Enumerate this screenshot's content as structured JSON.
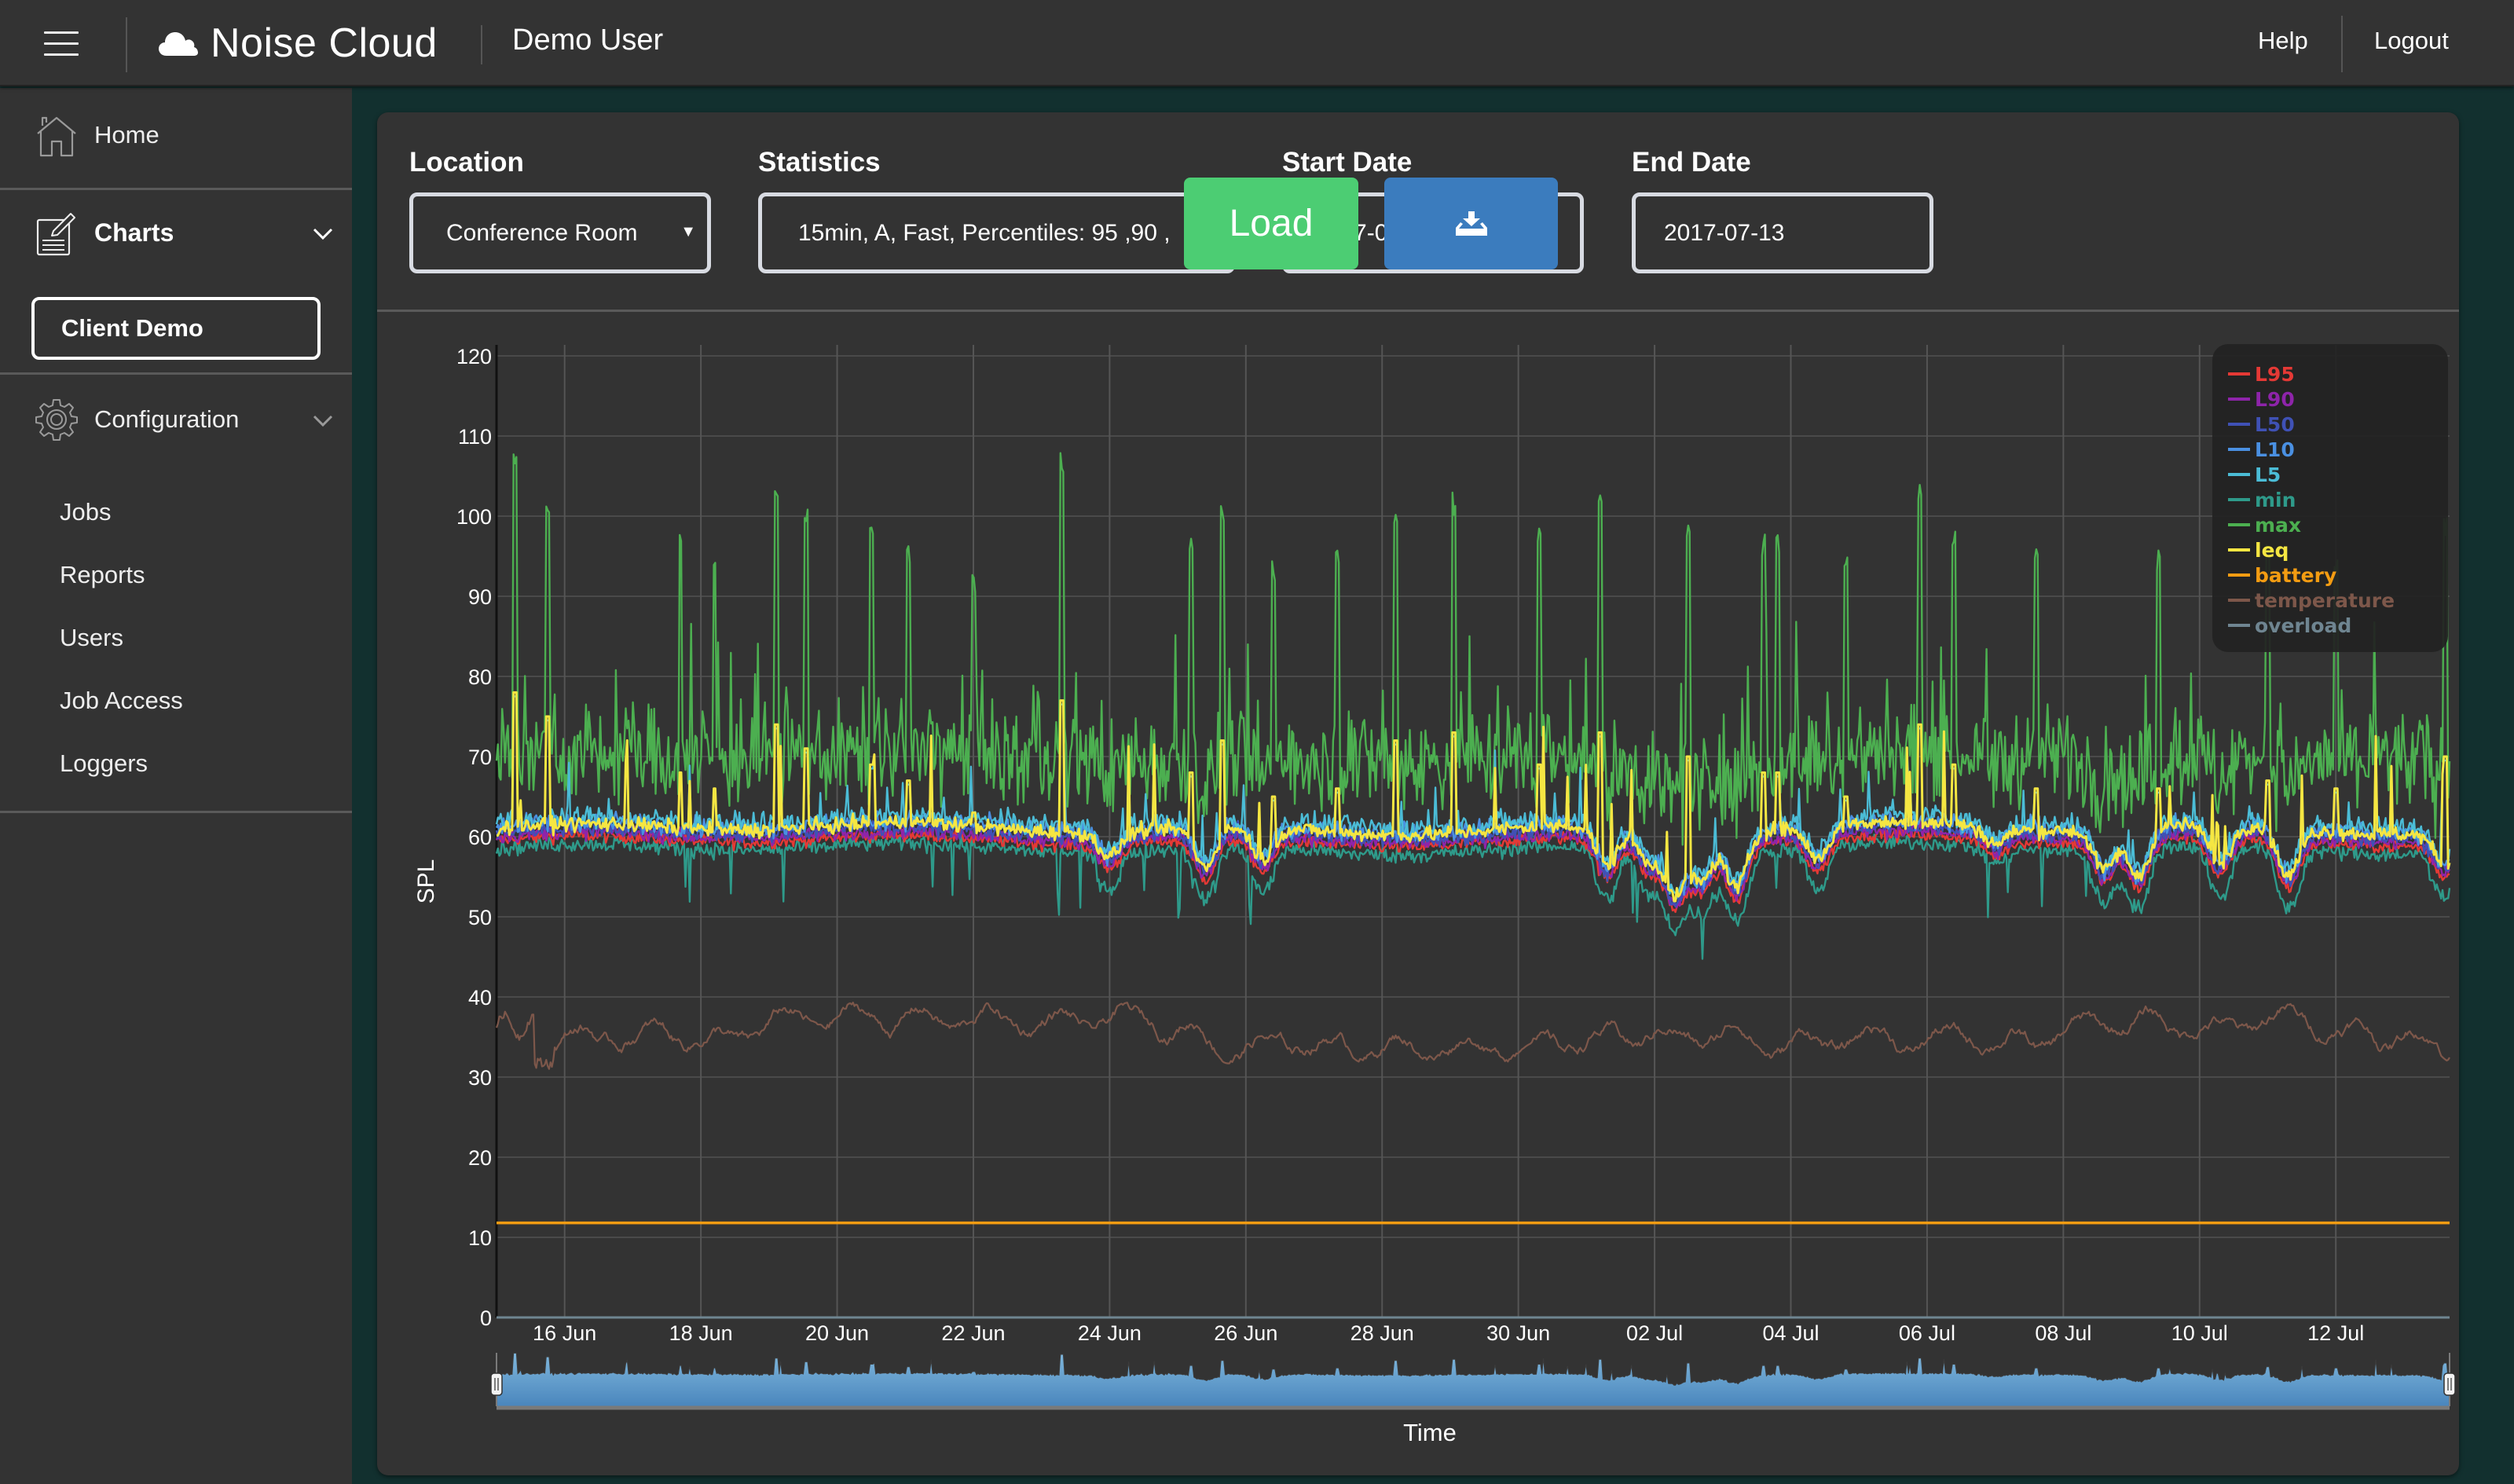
{
  "header": {
    "menu_icon": "hamburger-icon",
    "brand_icon": "cloud-icon",
    "brand": "Noise Cloud",
    "user": "Demo User",
    "help": "Help",
    "logout": "Logout"
  },
  "sidebar": {
    "home": {
      "label": "Home",
      "icon": "home-icon"
    },
    "charts": {
      "label": "Charts",
      "icon": "charts-edit-icon",
      "expanded": true,
      "children": [
        {
          "label": "Client Demo",
          "active": true
        }
      ]
    },
    "configuration": {
      "label": "Configuration",
      "icon": "gear-icon",
      "expanded": true,
      "children": [
        {
          "label": "Jobs"
        },
        {
          "label": "Reports"
        },
        {
          "label": "Users"
        },
        {
          "label": "Job Access"
        },
        {
          "label": "Loggers"
        }
      ]
    }
  },
  "filters": {
    "location": {
      "label": "Location",
      "value": "Conference Room"
    },
    "statistics": {
      "label": "Statistics",
      "value": "15min, A, Fast, Percentiles: 95 ,90 ,"
    },
    "start_date": {
      "label": "Start Date",
      "value": "2017-06-15"
    },
    "end_date": {
      "label": "End Date",
      "value": "2017-07-13"
    },
    "load_label": "Load",
    "download_icon": "download-tray-icon"
  },
  "chart_data": {
    "type": "line",
    "title": "",
    "xlabel": "Time",
    "ylabel": "SPL",
    "ylim": [
      0,
      120
    ],
    "yticks": [
      0,
      10,
      20,
      30,
      40,
      50,
      60,
      70,
      80,
      90,
      100,
      110,
      120
    ],
    "xlim": [
      "2017-06-15T00:00",
      "2017-07-13T16:00"
    ],
    "xticks": [
      "16 Jun",
      "18 Jun",
      "20 Jun",
      "22 Jun",
      "24 Jun",
      "26 Jun",
      "28 Jun",
      "30 Jun",
      "02 Jul",
      "04 Jul",
      "06 Jul",
      "08 Jul",
      "10 Jul",
      "12 Jul"
    ],
    "xtick_days": [
      1,
      3,
      5,
      7,
      9,
      11,
      13,
      15,
      17,
      19,
      21,
      23,
      25,
      27
    ],
    "grid": true,
    "legend_position": "top-right",
    "sample_interval": "15min",
    "series": [
      {
        "name": "L95",
        "color": "#e53935",
        "typical": 59.5,
        "noise": 0.8
      },
      {
        "name": "L90",
        "color": "#8e24aa",
        "typical": 60.0,
        "noise": 0.9
      },
      {
        "name": "L50",
        "color": "#3f51b5",
        "typical": 60.5,
        "noise": 1.0
      },
      {
        "name": "L10",
        "color": "#4a90e2",
        "typical": 61.3,
        "noise": 1.2
      },
      {
        "name": "L5",
        "color": "#4bbcd6",
        "typical": 61.8,
        "noise": 1.4
      },
      {
        "name": "min",
        "color": "#2e9a8a",
        "typical": 58.5,
        "noise": 1.0
      },
      {
        "name": "max",
        "color": "#4caf50",
        "typical": 70,
        "noise": 4.5
      },
      {
        "name": "leq",
        "color": "#f5e642",
        "typical": 61,
        "noise": 0.9
      },
      {
        "name": "battery",
        "color": "#f39c12",
        "typical": 11.8,
        "noise": 0
      },
      {
        "name": "temperature",
        "color": "#7d574a",
        "typical": 35,
        "noise": 1.6
      },
      {
        "name": "overload",
        "color": "#6f8591",
        "typical": 0,
        "noise": 0
      }
    ],
    "max_spikes": [
      {
        "day": 0.28,
        "max": 109,
        "leq": 78
      },
      {
        "day": 0.75,
        "max": 102,
        "leq": 75
      },
      {
        "day": 2.7,
        "max": 98
      },
      {
        "day": 3.2,
        "max": 96
      },
      {
        "day": 4.1,
        "max": 104
      },
      {
        "day": 4.55,
        "max": 101
      },
      {
        "day": 5.5,
        "max": 99
      },
      {
        "day": 6.05,
        "max": 97
      },
      {
        "day": 7.0,
        "max": 93
      },
      {
        "day": 8.3,
        "max": 108,
        "leq": 77
      },
      {
        "day": 10.2,
        "max": 98
      },
      {
        "day": 10.65,
        "max": 102
      },
      {
        "day": 11.4,
        "max": 95
      },
      {
        "day": 12.35,
        "max": 96
      },
      {
        "day": 13.2,
        "max": 102
      },
      {
        "day": 14.05,
        "max": 103
      },
      {
        "day": 15.3,
        "max": 99
      },
      {
        "day": 16.2,
        "max": 103
      },
      {
        "day": 17.5,
        "max": 100
      },
      {
        "day": 18.6,
        "max": 98
      },
      {
        "day": 18.8,
        "max": 98
      },
      {
        "day": 19.8,
        "max": 95
      },
      {
        "day": 20.9,
        "max": 104
      },
      {
        "day": 21.4,
        "max": 99
      },
      {
        "day": 22.6,
        "max": 96
      },
      {
        "day": 24.4,
        "max": 96
      },
      {
        "day": 26.0,
        "max": 97
      },
      {
        "day": 27.0,
        "max": 96
      },
      {
        "day": 28.6,
        "max": 100
      }
    ],
    "level_dips": [
      {
        "day": 9.0,
        "depth": 3
      },
      {
        "day": 10.4,
        "depth": 5
      },
      {
        "day": 11.25,
        "depth": 4
      },
      {
        "day": 16.3,
        "depth": 5
      },
      {
        "day": 16.9,
        "depth": 4
      },
      {
        "day": 17.3,
        "depth": 8
      },
      {
        "day": 17.7,
        "depth": 6
      },
      {
        "day": 18.2,
        "depth": 7
      },
      {
        "day": 19.4,
        "depth": 4
      },
      {
        "day": 22.0,
        "depth": 2
      },
      {
        "day": 23.6,
        "depth": 5
      },
      {
        "day": 24.1,
        "depth": 6
      },
      {
        "day": 25.3,
        "depth": 5
      },
      {
        "day": 26.3,
        "depth": 6
      },
      {
        "day": 28.6,
        "depth": 4
      }
    ],
    "temperature_dip": {
      "start_day": 0.55,
      "end_day": 0.85,
      "value": 31
    },
    "navigator": {
      "series": "leq",
      "range_start": "2017-06-15",
      "range_end": "2017-07-13",
      "fill_top": "#7fb7dc",
      "fill_bottom": "#4a86bd"
    }
  }
}
